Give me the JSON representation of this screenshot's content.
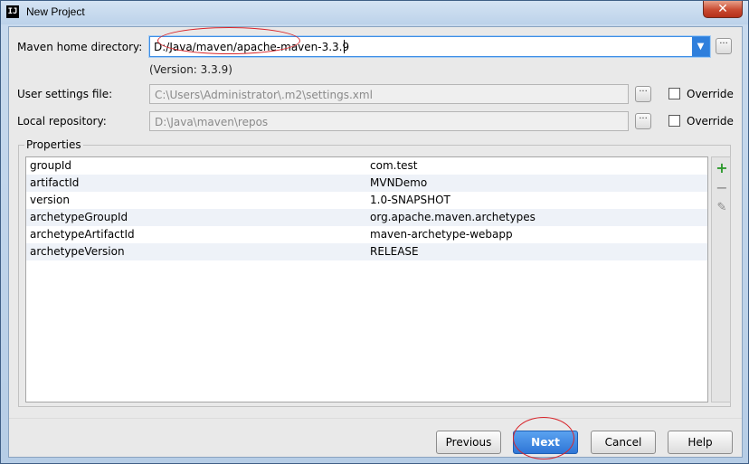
{
  "window": {
    "title": "New Project",
    "app_icon_text": "IJ",
    "close_glyph": "✕"
  },
  "form": {
    "maven_home": {
      "label": "Maven home directory:",
      "value": "D:/Java/maven/apache-maven-3.3.9",
      "version_note": "(Version: 3.3.9)"
    },
    "user_settings": {
      "label": "User settings file:",
      "value": "C:\\Users\\Administrator\\.m2\\settings.xml",
      "override_label": "Override",
      "override_checked": false
    },
    "local_repository": {
      "label": "Local repository:",
      "value": "D:\\Java\\maven\\repos",
      "override_label": "Override",
      "override_checked": false
    },
    "browse_glyph": "···"
  },
  "properties": {
    "title": "Properties",
    "rows": [
      {
        "key": "groupId",
        "value": "com.test"
      },
      {
        "key": "artifactId",
        "value": "MVNDemo"
      },
      {
        "key": "version",
        "value": "1.0-SNAPSHOT"
      },
      {
        "key": "archetypeGroupId",
        "value": "org.apache.maven.archetypes"
      },
      {
        "key": "archetypeArtifactId",
        "value": "maven-archetype-webapp"
      },
      {
        "key": "archetypeVersion",
        "value": "RELEASE"
      }
    ],
    "tools": {
      "add_glyph": "+",
      "remove_glyph": "−",
      "edit_glyph": "✎"
    }
  },
  "buttons": {
    "previous": "Previous",
    "next": "Next",
    "cancel": "Cancel",
    "help": "Help"
  },
  "colors": {
    "accent": "#2f7fdc",
    "annotation": "#d8262c",
    "add": "#2e9a2e"
  }
}
